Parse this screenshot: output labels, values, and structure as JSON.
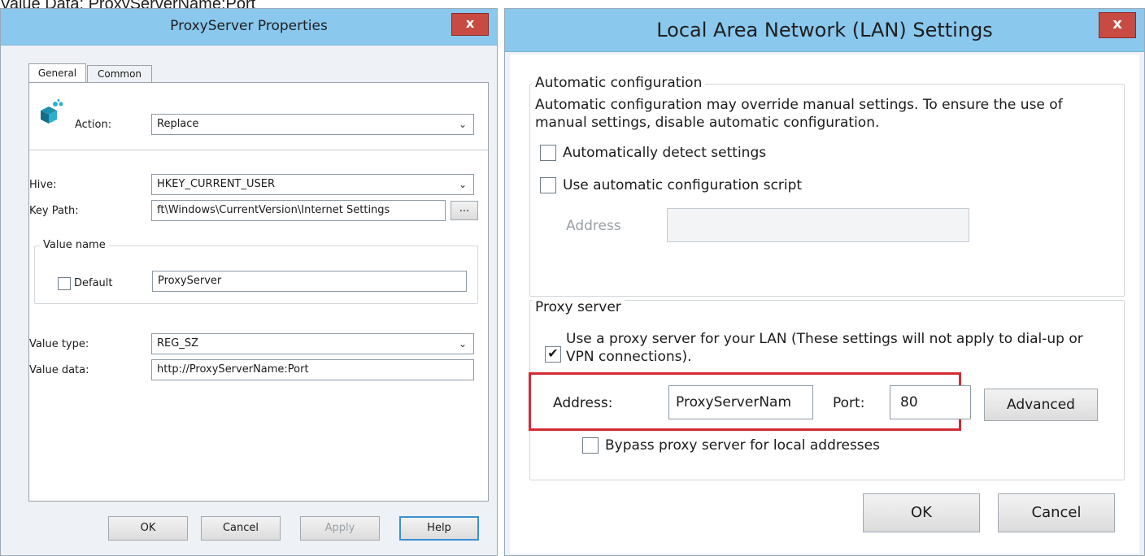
{
  "caption": "Value Data: ProxyServerName:Port",
  "left_window": {
    "title": "ProxyServer Properties",
    "close_glyph": "x",
    "tabs": [
      "General",
      "Common"
    ],
    "action_label": "Action:",
    "action_value": "Replace",
    "hive_label": "Hive:",
    "hive_value": "HKEY_CURRENT_USER",
    "keypath_label": "Key Path:",
    "keypath_value": "ft\\Windows\\CurrentVersion\\Internet Settings",
    "browse_label": "...",
    "value_name_group": "Value name",
    "default_label": "Default",
    "value_name_value": "ProxyServer",
    "value_type_label": "Value type:",
    "value_type_value": "REG_SZ",
    "value_data_label": "Value data:",
    "value_data_value": "http://ProxyServerName:Port",
    "buttons": {
      "ok": "OK",
      "cancel": "Cancel",
      "apply": "Apply",
      "help": "Help"
    }
  },
  "right_window": {
    "title": "Local Area Network (LAN) Settings",
    "close_glyph": "x",
    "auto_group": "Automatic configuration",
    "auto_desc": "Automatic configuration may override manual settings.  To ensure the use of manual settings, disable automatic configuration.",
    "auto_detect_label": "Automatically detect settings",
    "auto_script_label": "Use automatic configuration script",
    "address_label_disabled": "Address",
    "proxy_group": "Proxy server",
    "use_proxy_label": "Use a proxy server for your LAN (These settings will not apply to dial-up or VPN connections).",
    "address_label": "Address:",
    "address_value": "ProxyServerNam",
    "port_label": "Port:",
    "port_value": "80",
    "advanced_label": "Advanced",
    "bypass_label": "Bypass proxy server for local addresses",
    "buttons": {
      "ok": "OK",
      "cancel": "Cancel"
    },
    "highlight_color": "#d42a33"
  }
}
